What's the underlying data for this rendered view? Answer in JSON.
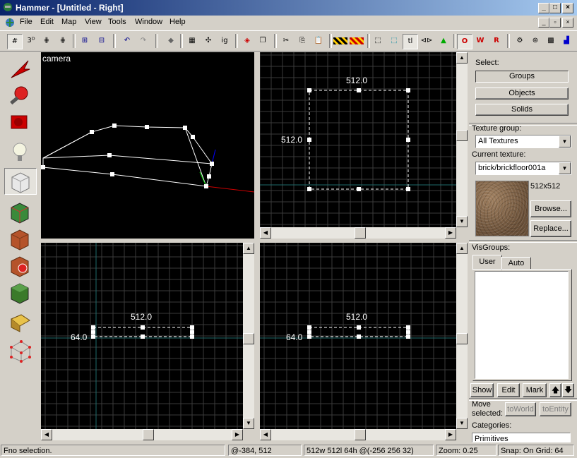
{
  "window": {
    "title": "Hammer - [Untitled - Right]",
    "controls": [
      "_",
      "□",
      "×"
    ],
    "mdi_controls": [
      "_",
      "▫",
      "×"
    ]
  },
  "menu": [
    "File",
    "Edit",
    "Map",
    "View",
    "Tools",
    "Window",
    "Help"
  ],
  "viewports": {
    "camera": {
      "label": "camera"
    },
    "top_right": {
      "width_label": "512.0",
      "height_label": "512.0"
    },
    "bottom_left": {
      "width_label": "512.0",
      "height_label": "64.0"
    },
    "bottom_right": {
      "width_label": "512.0",
      "height_label": "64.0"
    }
  },
  "right_panel": {
    "select_label": "Select:",
    "select_buttons": [
      "Groups",
      "Objects",
      "Solids"
    ],
    "texture_group_label": "Texture group:",
    "texture_group_value": "All Textures",
    "current_texture_label": "Current texture:",
    "current_texture_value": "brick/brickfloor001a",
    "texture_size": "512x512",
    "browse_button": "Browse...",
    "replace_button": "Replace...",
    "visgroups_label": "VisGroups:",
    "tabs": [
      "User",
      "Auto"
    ],
    "list_buttons": {
      "show": "Show",
      "edit": "Edit",
      "mark": "Mark",
      "up": "🡅",
      "down": "🡇"
    },
    "move_selected_label": "Move selected:",
    "to_world": "toWorld",
    "to_entity": "toEntity",
    "categories_label": "Categories:",
    "categories_value": "Primitives"
  },
  "status": {
    "help": "F",
    "message": "no selection.",
    "coords": "@-384, 512",
    "dimensions": "512w 512l 64h @(-256 256 32)",
    "zoom": "Zoom: 0.25",
    "snap": "Snap: On Grid: 64"
  },
  "colors": {
    "grid_line": "#3a3a3a",
    "grid_axis": "#1e6a6a",
    "axis_x": "#cc0000",
    "axis_y": "#00cc00",
    "axis_z": "#0000ff",
    "title_start": "#0a246a",
    "title_end": "#a6caf0"
  }
}
